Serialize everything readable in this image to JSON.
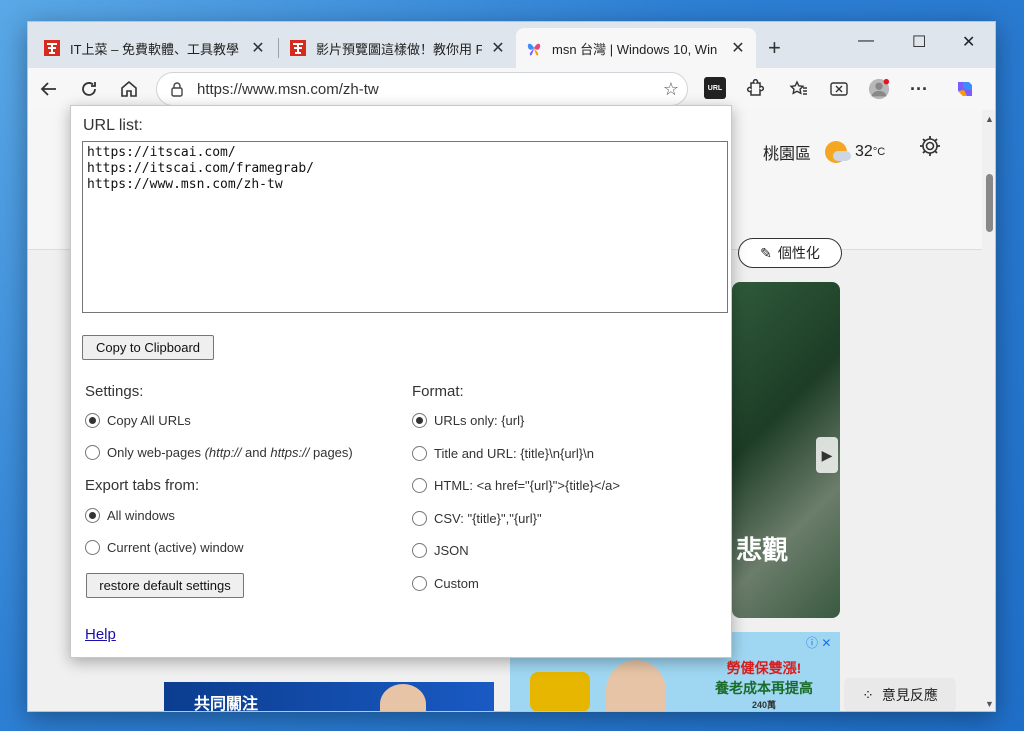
{
  "browser": {
    "tabs": [
      {
        "title": "IT上菜 – 免費軟體、工具教學",
        "active": false
      },
      {
        "title": "影片預覽圖這樣做！教你用 Fr",
        "active": false
      },
      {
        "title": "msn 台灣 | Windows 10, Win",
        "active": true
      }
    ],
    "address": "https://www.msn.com/zh-tw",
    "url_ext_label": "URL"
  },
  "msn": {
    "location": "桃園區",
    "temperature": "32",
    "unit": "°C",
    "personalize": "個性化",
    "card_text": "悲觀",
    "ad_tv_text": "共同關注",
    "ad_line1": "勞健保雙漲!",
    "ad_line2": "養老成本再提高",
    "ad_line3": "240萬",
    "feedback": "意見反應"
  },
  "popup": {
    "title": "URL list:",
    "urls": "https://itscai.com/\nhttps://itscai.com/framegrab/\nhttps://www.msn.com/zh-tw",
    "copy_button": "Copy to Clipboard",
    "settings_label": "Settings:",
    "settings_opt1": "Copy All URLs",
    "settings_opt2_prefix": "Only web-pages ",
    "settings_opt2_http": "(http://",
    "settings_opt2_and": " and ",
    "settings_opt2_https": "https://",
    "settings_opt2_suffix": " pages)",
    "export_label": "Export tabs from:",
    "export_opt1": "All windows",
    "export_opt2": "Current (active) window",
    "restore_button": "restore default settings",
    "format_label": "Format:",
    "formats": [
      "URLs only: {url}",
      "Title and URL: {title}\\n{url}\\n",
      "HTML: <a href=\"{url}\">{title}</a>",
      "CSV: \"{title}\",\"{url}\"",
      "JSON",
      "Custom"
    ],
    "help": "Help"
  }
}
